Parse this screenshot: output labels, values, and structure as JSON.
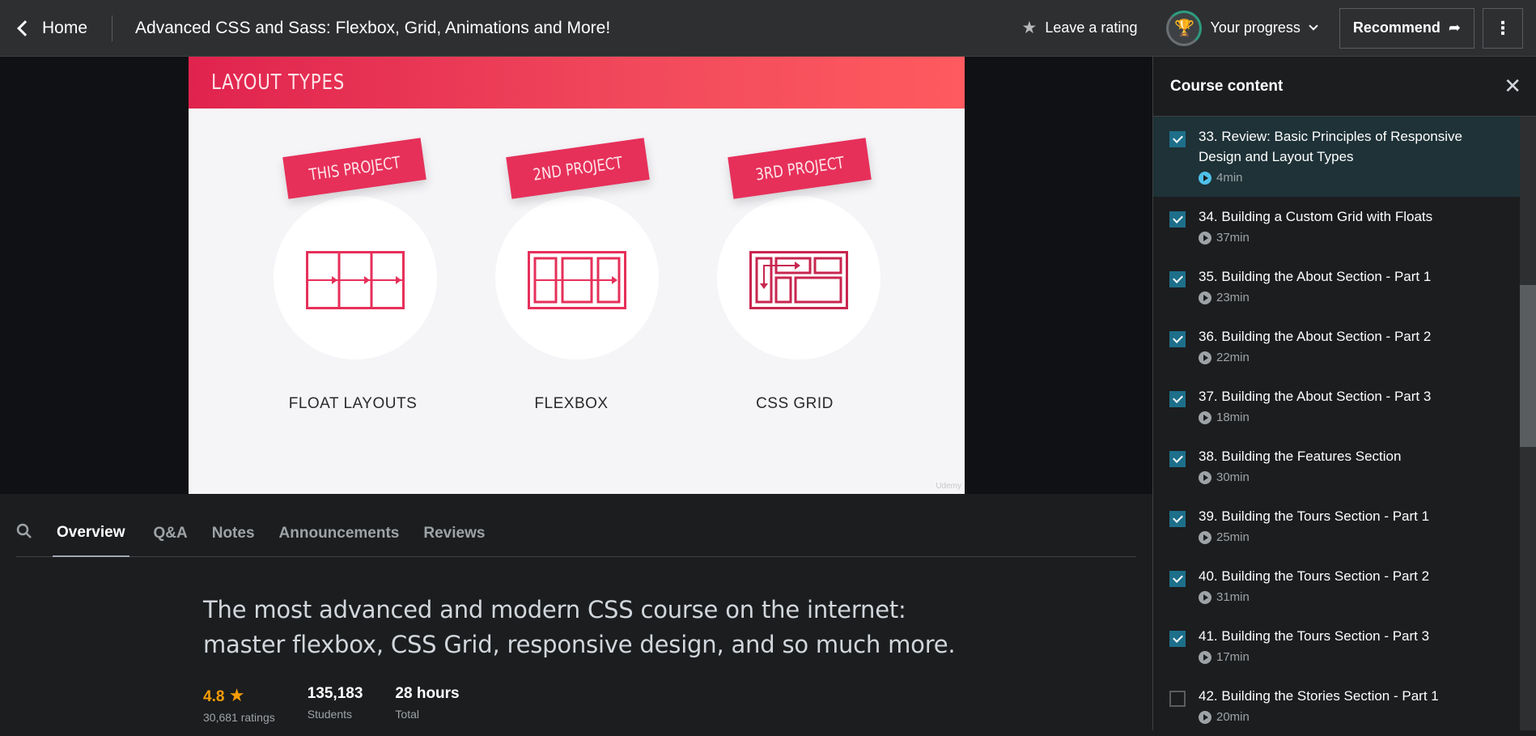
{
  "header": {
    "home_label": "Home",
    "course_title": "Advanced CSS and Sass: Flexbox, Grid, Animations and More!",
    "rating_label": "Leave a rating",
    "progress_label": "Your progress",
    "recommend_label": "Recommend"
  },
  "slide": {
    "title": "LAYOUT TYPES",
    "cards": [
      {
        "tag": "THIS PROJECT",
        "label": "FLOAT LAYOUTS"
      },
      {
        "tag": "2ND PROJECT",
        "label": "FLEXBOX"
      },
      {
        "tag": "3RD PROJECT",
        "label": "CSS GRID"
      }
    ],
    "watermark": "Udemy"
  },
  "tabs": [
    "Overview",
    "Q&A",
    "Notes",
    "Announcements",
    "Reviews"
  ],
  "active_tab": "Overview",
  "overview": {
    "headline": "The most advanced and modern CSS course on the internet: master flexbox, CSS Grid, responsive design, and so much more.",
    "rating_value": "4.8",
    "rating_count": "30,681 ratings",
    "students_value": "135,183",
    "students_label": "Students",
    "hours_value": "28 hours",
    "hours_label": "Total"
  },
  "sidebar": {
    "title": "Course content",
    "lectures": [
      {
        "title": "33. Review: Basic Principles of Responsive Design and Layout Types",
        "duration": "4min",
        "done": true,
        "active": true
      },
      {
        "title": "34. Building a Custom Grid with Floats",
        "duration": "37min",
        "done": true,
        "active": false
      },
      {
        "title": "35. Building the About Section - Part 1",
        "duration": "23min",
        "done": true,
        "active": false
      },
      {
        "title": "36. Building the About Section - Part 2",
        "duration": "22min",
        "done": true,
        "active": false
      },
      {
        "title": "37. Building the About Section - Part 3",
        "duration": "18min",
        "done": true,
        "active": false
      },
      {
        "title": "38. Building the Features Section",
        "duration": "30min",
        "done": true,
        "active": false
      },
      {
        "title": "39. Building the Tours Section - Part 1",
        "duration": "25min",
        "done": true,
        "active": false
      },
      {
        "title": "40. Building the Tours Section - Part 2",
        "duration": "31min",
        "done": true,
        "active": false
      },
      {
        "title": "41. Building the Tours Section - Part 3",
        "duration": "17min",
        "done": true,
        "active": false
      },
      {
        "title": "42. Building the Stories Section - Part 1",
        "duration": "20min",
        "done": false,
        "active": false
      }
    ]
  },
  "colors": {
    "accent": "#e6305a",
    "rating": "#f69c08",
    "checkbox": "#1d6f8a"
  }
}
